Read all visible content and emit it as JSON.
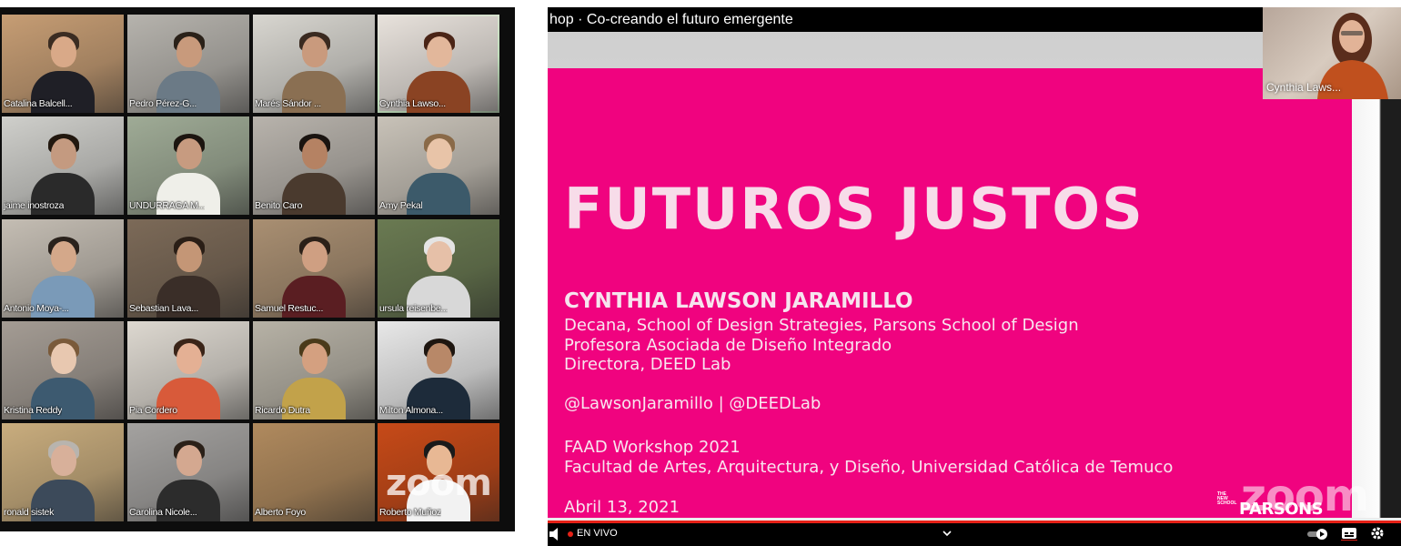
{
  "gallery": {
    "participants": [
      {
        "name": "Catalina Balcell...",
        "active": false
      },
      {
        "name": "Pedro Pérez-G...",
        "active": false
      },
      {
        "name": "Marés Sándor ...",
        "active": false
      },
      {
        "name": "Cynthia Lawso...",
        "active": true
      },
      {
        "name": "jaime inostroza",
        "active": false
      },
      {
        "name": "UNDURRAGA M...",
        "active": false
      },
      {
        "name": "Benito Caro",
        "active": false
      },
      {
        "name": "Amy Pekal",
        "active": false
      },
      {
        "name": "Antonio Moya-...",
        "active": false
      },
      {
        "name": "Sebastian Lava...",
        "active": false
      },
      {
        "name": "Samuel Restuc...",
        "active": false
      },
      {
        "name": "ursula reisenbe...",
        "active": false
      },
      {
        "name": "Kristina Reddy",
        "active": false
      },
      {
        "name": "Pia Cordero",
        "active": false
      },
      {
        "name": "Ricardo Dutra",
        "active": false
      },
      {
        "name": "Milton Almona...",
        "active": false
      },
      {
        "name": "ronald sistek",
        "active": false
      },
      {
        "name": "Carolina Nicole...",
        "active": false
      },
      {
        "name": "Alberto Foyo",
        "active": false
      },
      {
        "name": "Roberto Muñoz",
        "active": false
      }
    ],
    "watermark": "zoom"
  },
  "player": {
    "title": "hop · Co-creando el futuro emergente",
    "pip_name": "Cynthia Laws...",
    "live_label": "EN VIVO",
    "watermark": "zoom"
  },
  "slide": {
    "heading": "FUTUROS JUSTOS",
    "speaker": "CYNTHIA LAWSON JARAMILLO",
    "roles": [
      "Decana, School of Design Strategies, Parsons School of Design",
      "Profesora Asociada de Diseño Integrado",
      "Directora, DEED Lab"
    ],
    "handles": "@LawsonJaramillo | @DEEDLab",
    "event": "FAAD Workshop 2021",
    "faculty": "Facultad de Artes, Arquitectura, y Diseño, Universidad Católica de Temuco",
    "date": "Abril 13, 2021",
    "logo_small": [
      "THE",
      "NEW",
      "SCHOOL"
    ],
    "logo": "PARSONS"
  },
  "colors": {
    "slide_magenta": "#f0037f",
    "active_speaker": "#23d13b",
    "live_red": "#e62117"
  }
}
